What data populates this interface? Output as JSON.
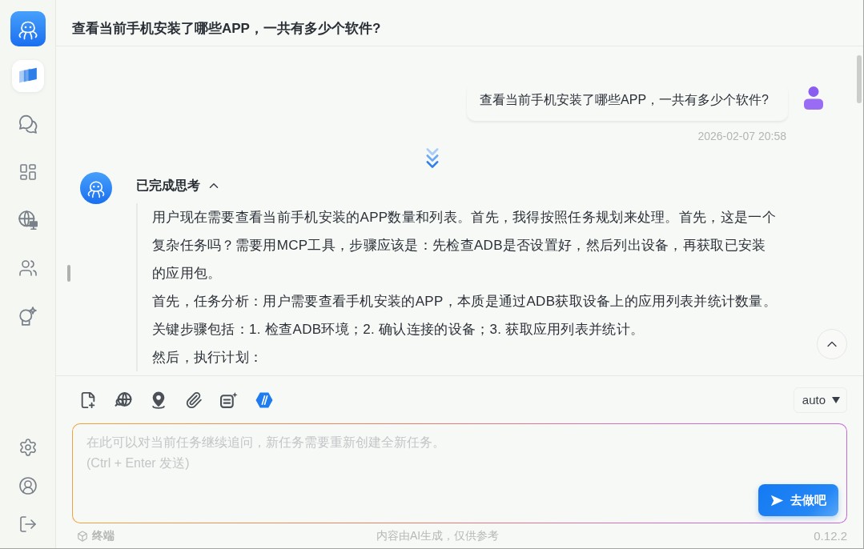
{
  "sidebar": {
    "nav_items": [
      {
        "selected": true
      },
      {
        "selected": false
      },
      {
        "selected": false
      },
      {
        "selected": false
      },
      {
        "selected": false
      },
      {
        "selected": false
      }
    ]
  },
  "header": {
    "title": "查看当前手机安装了哪些APP，一共有多少个软件?"
  },
  "messages": [
    {
      "kind": "user",
      "text": "查看当前手机安装了哪些APP，一共有多少个软件?",
      "time": "2026-02-07 20:58"
    },
    {
      "kind": "assistant",
      "thinking": {
        "label": "已完成思考",
        "expanded": true,
        "paragraphs": [
          "用户现在需要查看当前手机安装的APP数量和列表。首先，我得按照任务规划来处理。首先，这是一个复杂任务吗？需要用MCP工具，步骤应该是：先检查ADB是否设置好，然后列出设备，再获取已安装的应用包。",
          "首先，任务分析：用户需要查看手机安装的APP，本质是通过ADB获取设备上的应用列表并统计数量。关键步骤包括：1. 检查ADB环境；2. 确认连接的设备；3. 获取应用列表并统计。",
          "然后，执行计划："
        ]
      }
    }
  ],
  "composer": {
    "tools": [
      {
        "on": false
      },
      {
        "on": false
      },
      {
        "on": false
      },
      {
        "on": false
      },
      {
        "on": false
      },
      {
        "on": true
      }
    ],
    "model": "auto",
    "placeholder": "在此可以对当前任务继续追问，新任务需要重新创建全新任务。\n(Ctrl + Enter 发送)",
    "send_label": "去做吧"
  },
  "footer": {
    "terminal": "终端",
    "notice": "内容由AI生成，仅供参考",
    "version": "0.12.2"
  }
}
